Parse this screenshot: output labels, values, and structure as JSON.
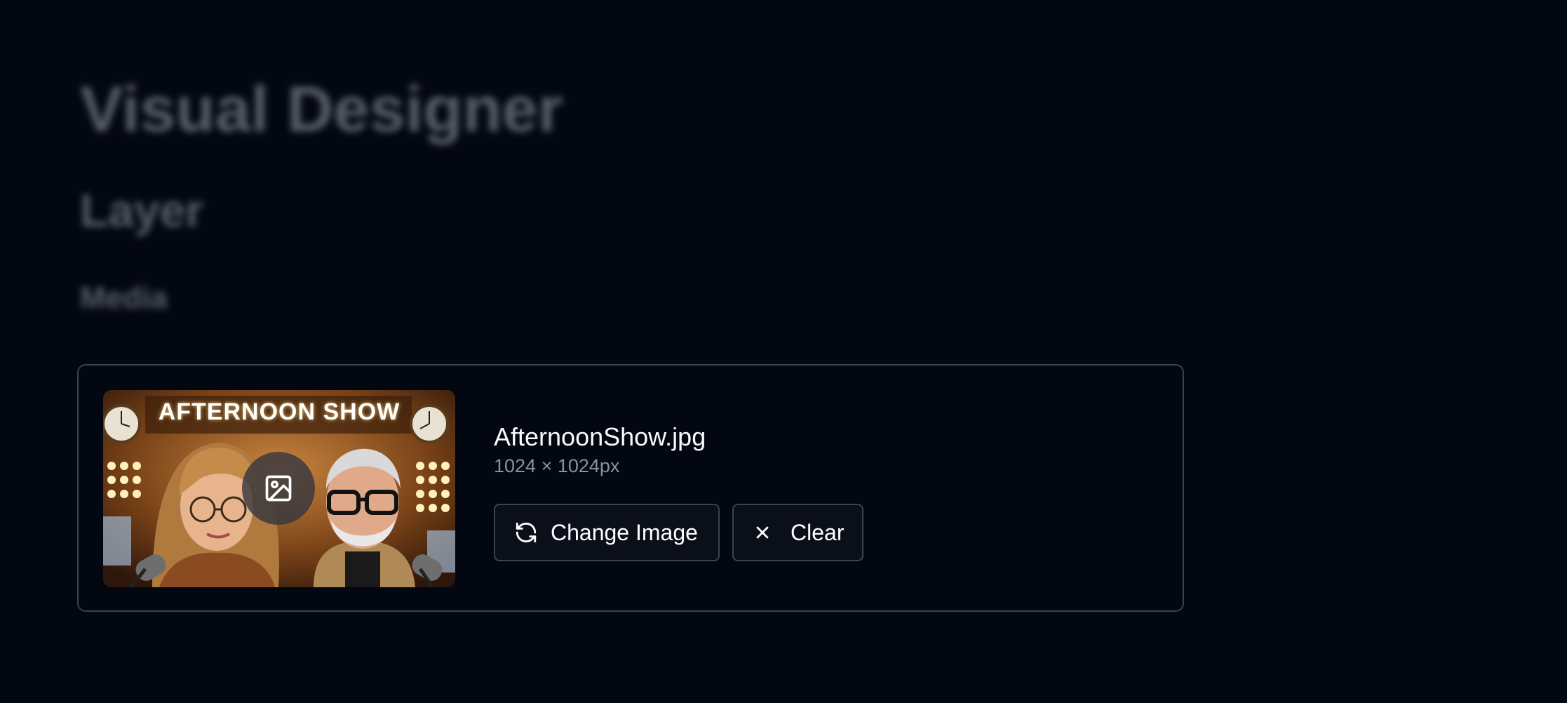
{
  "background": {
    "title": "Visual Designer",
    "section": "Layer",
    "subsection": "Media"
  },
  "media_card": {
    "thumbnail": {
      "banner_text": "AFTERNOON SHOW",
      "overlay_icon": "image-icon"
    },
    "file_name": "AfternoonShow.jpg",
    "dimensions": "1024 × 1024px",
    "buttons": {
      "change": {
        "label": "Change Image",
        "icon": "refresh-icon"
      },
      "clear": {
        "label": "Clear",
        "icon": "close-icon"
      }
    }
  },
  "colors": {
    "page_background": "#030712",
    "card_border": "#3b4257",
    "text_primary": "#f9fafb",
    "text_muted": "#8b919e"
  }
}
